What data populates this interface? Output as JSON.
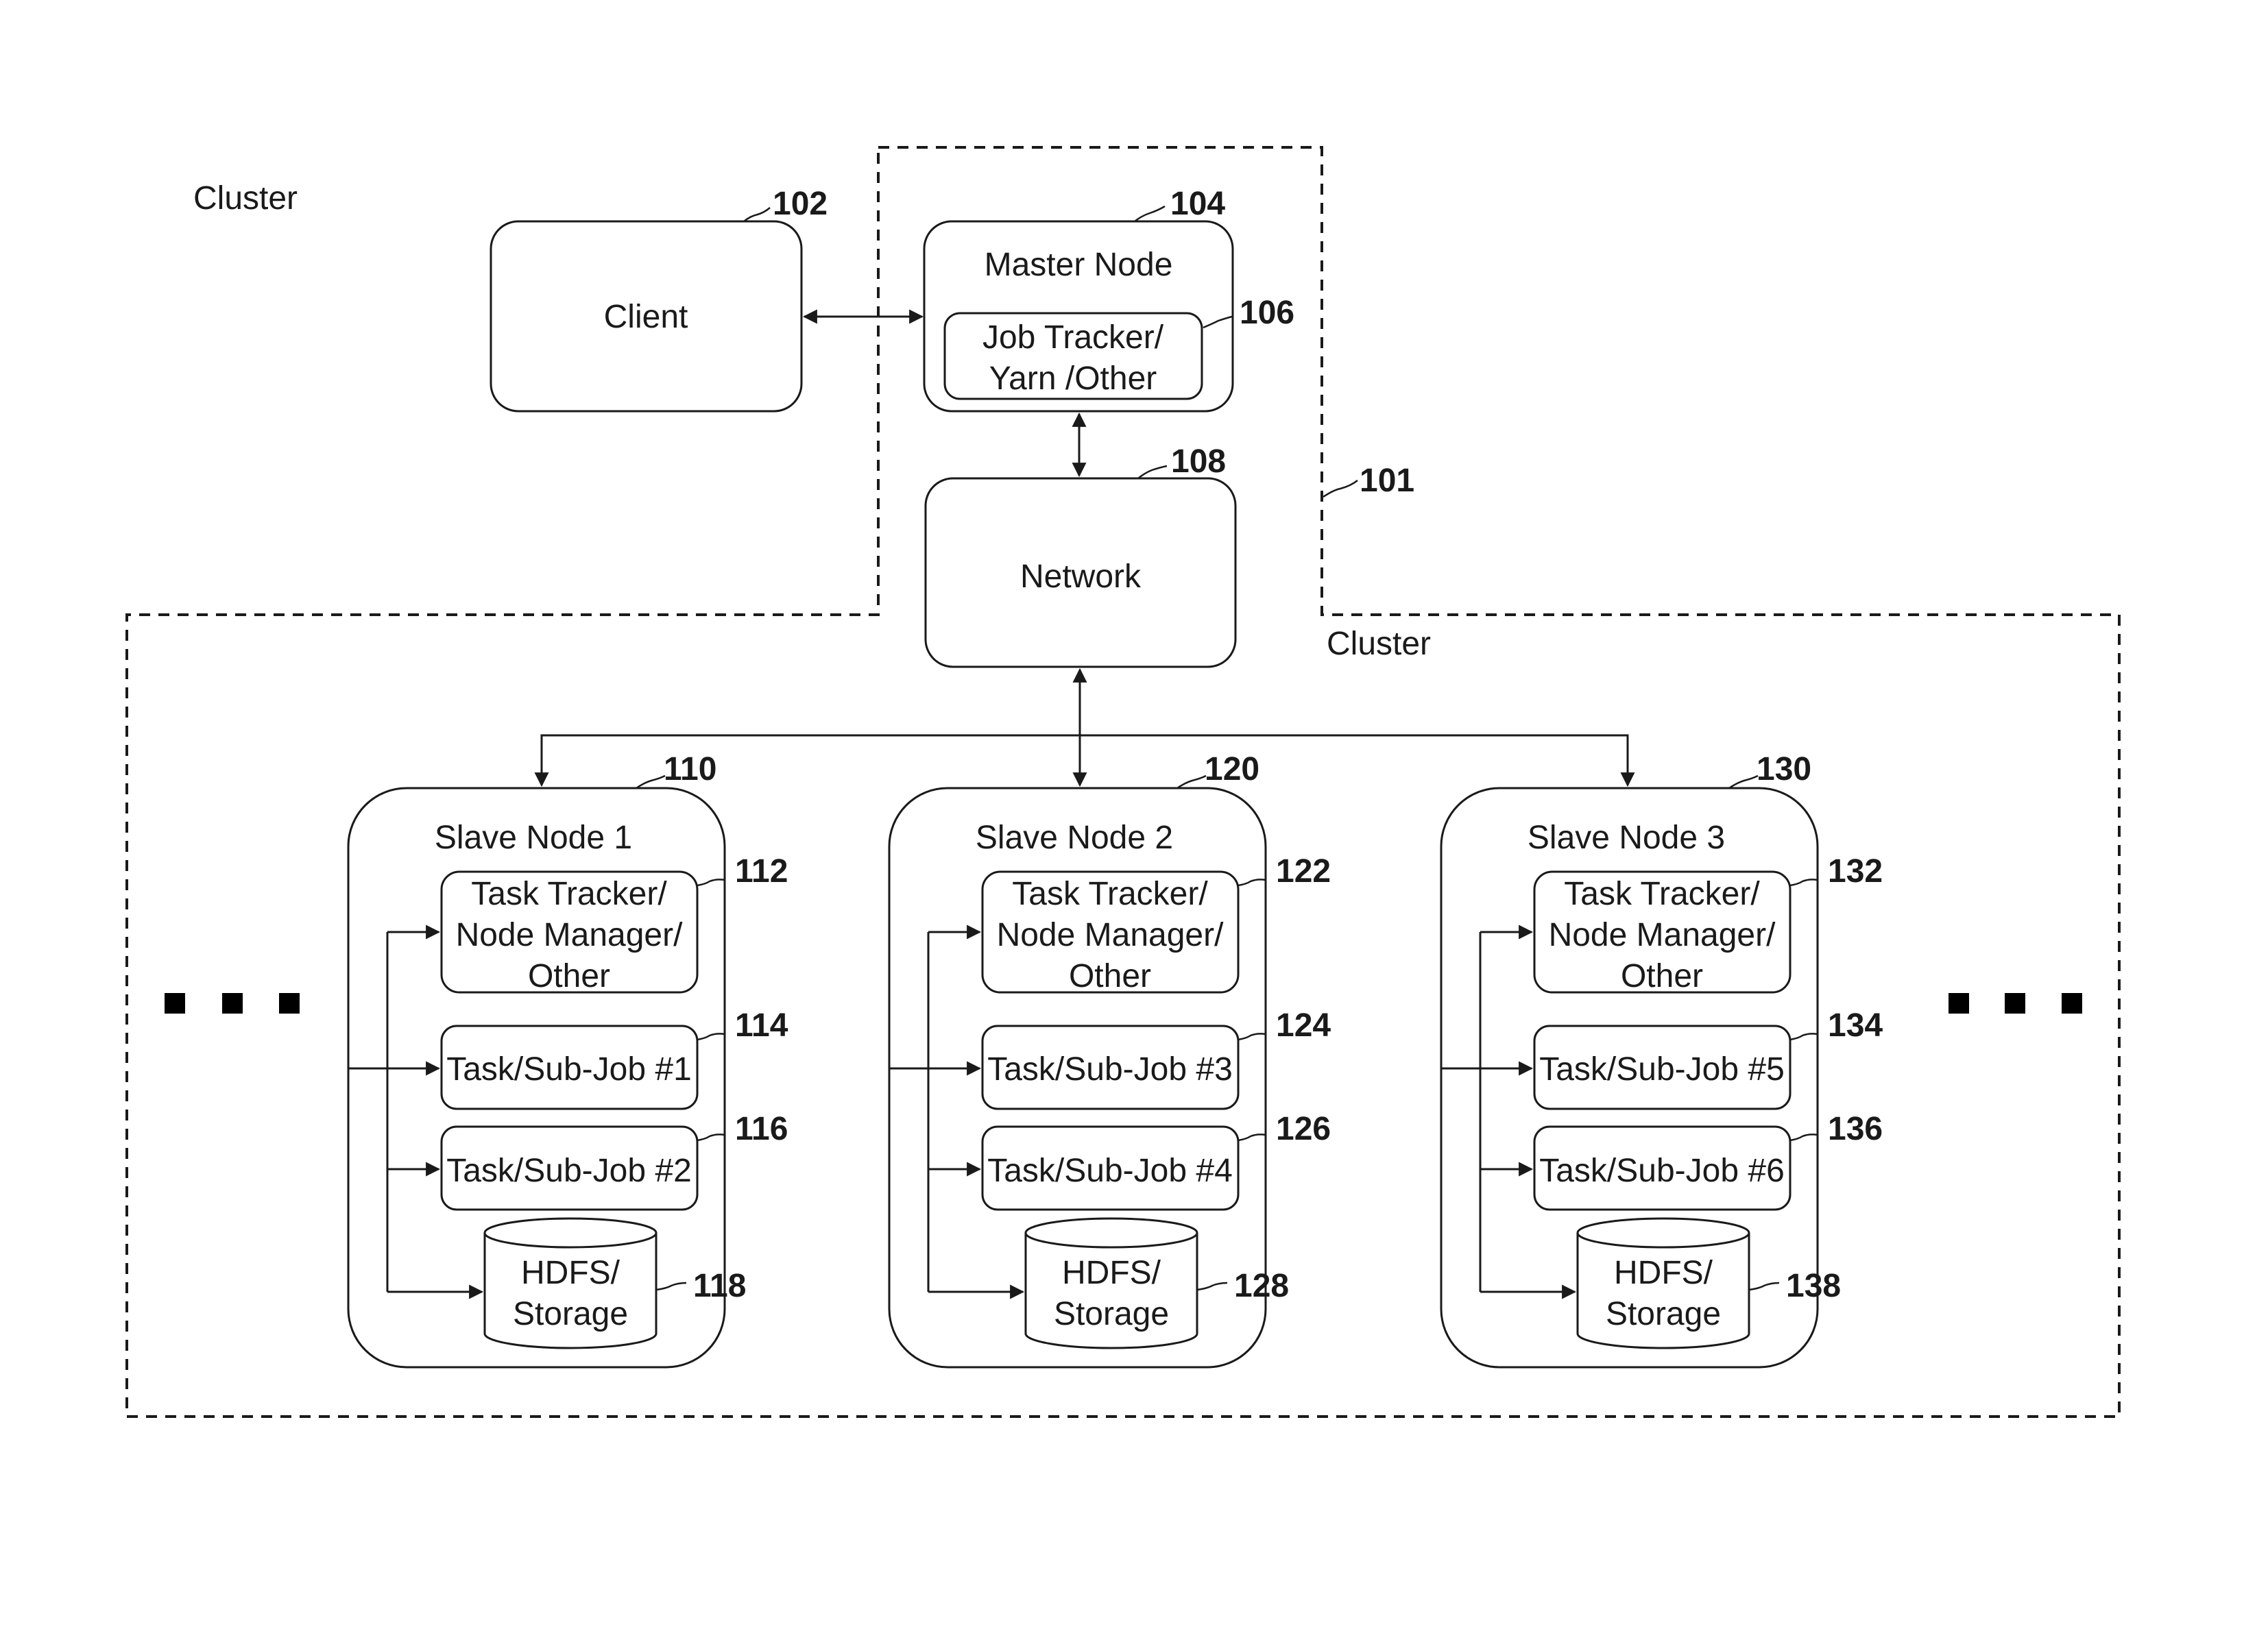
{
  "diagram": {
    "top_cluster_label": "Cluster",
    "bottom_cluster_label": "Cluster",
    "cluster_ref": "101",
    "client": {
      "label": "Client",
      "ref": "102"
    },
    "master": {
      "label": "Master Node",
      "ref": "104",
      "job_tracker": {
        "lines": [
          "Job Tracker/",
          "Yarn /Other"
        ],
        "ref": "106"
      }
    },
    "network": {
      "label": "Network",
      "ref": "108"
    },
    "slaves": [
      {
        "label": "Slave Node 1",
        "ref": "110",
        "tracker": {
          "lines": [
            "Task Tracker/",
            "Node Manager/",
            "Other"
          ],
          "ref": "112"
        },
        "tasks": [
          {
            "label": "Task/Sub-Job #1",
            "ref": "114"
          },
          {
            "label": "Task/Sub-Job #2",
            "ref": "116"
          }
        ],
        "storage": {
          "lines": [
            "HDFS/",
            "Storage"
          ],
          "ref": "118"
        }
      },
      {
        "label": "Slave Node 2",
        "ref": "120",
        "tracker": {
          "lines": [
            "Task Tracker/",
            "Node Manager/",
            "Other"
          ],
          "ref": "122"
        },
        "tasks": [
          {
            "label": "Task/Sub-Job #3",
            "ref": "124"
          },
          {
            "label": "Task/Sub-Job #4",
            "ref": "126"
          }
        ],
        "storage": {
          "lines": [
            "HDFS/",
            "Storage"
          ],
          "ref": "128"
        }
      },
      {
        "label": "Slave Node 3",
        "ref": "130",
        "tracker": {
          "lines": [
            "Task Tracker/",
            "Node Manager/",
            "Other"
          ],
          "ref": "132"
        },
        "tasks": [
          {
            "label": "Task/Sub-Job #5",
            "ref": "134"
          },
          {
            "label": "Task/Sub-Job #6",
            "ref": "136"
          }
        ],
        "storage": {
          "lines": [
            "HDFS/",
            "Storage"
          ],
          "ref": "138"
        }
      }
    ],
    "ellipsis_left": "more-nodes-indicator",
    "ellipsis_right": "more-nodes-indicator"
  }
}
